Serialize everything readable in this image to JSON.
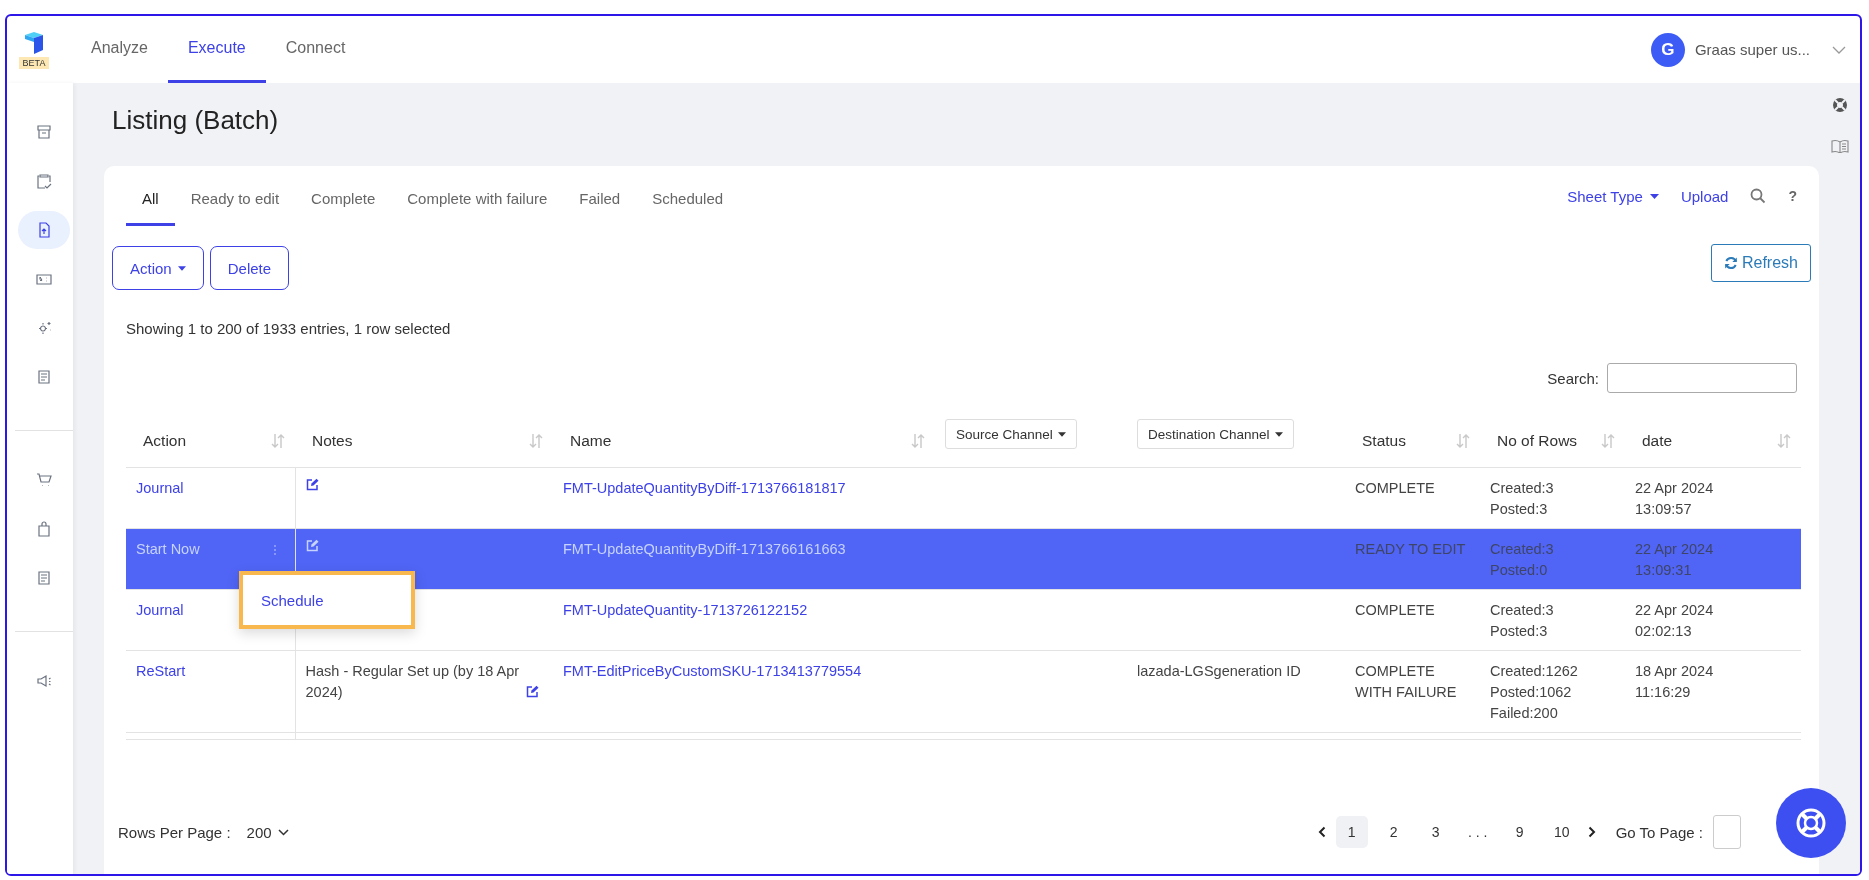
{
  "app": {
    "badge": "BETA"
  },
  "nav": [
    {
      "label": "Analyze",
      "selected": false
    },
    {
      "label": "Execute",
      "selected": true
    },
    {
      "label": "Connect",
      "selected": false
    }
  ],
  "user": {
    "initial": "G",
    "name": "Graas super us..."
  },
  "sidebar": {
    "groups": [
      {
        "items": [
          {
            "selected": false
          },
          {
            "selected": false
          },
          {
            "selected": true
          },
          {
            "selected": false
          },
          {
            "selected": false
          },
          {
            "selected": false
          }
        ]
      },
      {
        "items": [
          {
            "selected": false
          },
          {
            "selected": false
          },
          {
            "selected": false
          }
        ]
      },
      {
        "items": [
          {
            "selected": false
          }
        ]
      }
    ]
  },
  "page": {
    "title": "Listing (Batch)"
  },
  "tabs": [
    {
      "label": "All",
      "selected": true
    },
    {
      "label": "Ready to edit",
      "selected": false
    },
    {
      "label": "Complete",
      "selected": false
    },
    {
      "label": "Complete with failure",
      "selected": false
    },
    {
      "label": "Failed",
      "selected": false
    },
    {
      "label": "Scheduled",
      "selected": false
    }
  ],
  "toolbar": {
    "sheet_type": "Sheet Type",
    "upload": "Upload",
    "help": "?"
  },
  "buttons": {
    "action": "Action",
    "delete": "Delete",
    "refresh": "Refresh"
  },
  "summary": "Showing 1 to 200 of 1933 entries, 1 row selected",
  "search": {
    "label": "Search:"
  },
  "table": {
    "columns": [
      {
        "label": "Action",
        "kind": "sort"
      },
      {
        "label": "Notes",
        "kind": "sort"
      },
      {
        "label": "Name",
        "kind": "sort"
      },
      {
        "label": "Source Channel",
        "kind": "filter"
      },
      {
        "label": "Destination Channel",
        "kind": "filter"
      },
      {
        "label": "Status",
        "kind": "sort"
      },
      {
        "label": "No of Rows",
        "kind": "sort"
      },
      {
        "label": "date",
        "kind": "sort"
      }
    ],
    "rows": [
      {
        "selected": false,
        "action": "Journal",
        "notes": "",
        "name": "FMT-UpdateQuantityByDiff-1713766181817",
        "source": "",
        "destination": "",
        "status": [
          "COMPLETE"
        ],
        "counts": [
          "Created:3",
          "Posted:3"
        ],
        "date": [
          "22 Apr 2024",
          "13:09:57"
        ]
      },
      {
        "selected": true,
        "action": "Start Now",
        "notes": "",
        "name": "FMT-UpdateQuantityByDiff-1713766161663",
        "source": "",
        "destination": "",
        "status": [
          "READY TO EDIT"
        ],
        "counts": [
          "Created:3",
          "Posted:0"
        ],
        "date": [
          "22 Apr 2024",
          "13:09:31"
        ]
      },
      {
        "selected": false,
        "action": "Journal",
        "notes": "",
        "name": "FMT-UpdateQuantity-1713726122152",
        "source": "",
        "destination": "",
        "status": [
          "COMPLETE"
        ],
        "counts": [
          "Created:3",
          "Posted:3"
        ],
        "date": [
          "22 Apr 2024",
          "02:02:13"
        ]
      },
      {
        "selected": false,
        "action": "ReStart",
        "notes": "Hash - Regular Set up (by 18 Apr 2024)",
        "name": "FMT-EditPriceByCustomSKU-1713413779554",
        "source": "",
        "destination": "lazada-LGSgeneration ID",
        "status": [
          "COMPLETE",
          "WITH FAILURE"
        ],
        "counts": [
          "Created:1262",
          "Posted:1062",
          "Failed:200"
        ],
        "date": [
          "18 Apr 2024",
          "11:16:29"
        ]
      }
    ]
  },
  "context_menu": {
    "items": [
      "Schedule"
    ]
  },
  "pagination": {
    "rows_label": "Rows Per Page :",
    "rows_value": "200",
    "pages": [
      {
        "label": "1",
        "selected": true
      },
      {
        "label": "2",
        "selected": false
      },
      {
        "label": "3",
        "selected": false
      },
      {
        "label": ". . .",
        "selected": false
      },
      {
        "label": "9",
        "selected": false
      },
      {
        "label": "10",
        "selected": false
      }
    ],
    "goto_label": "Go To Page :"
  }
}
